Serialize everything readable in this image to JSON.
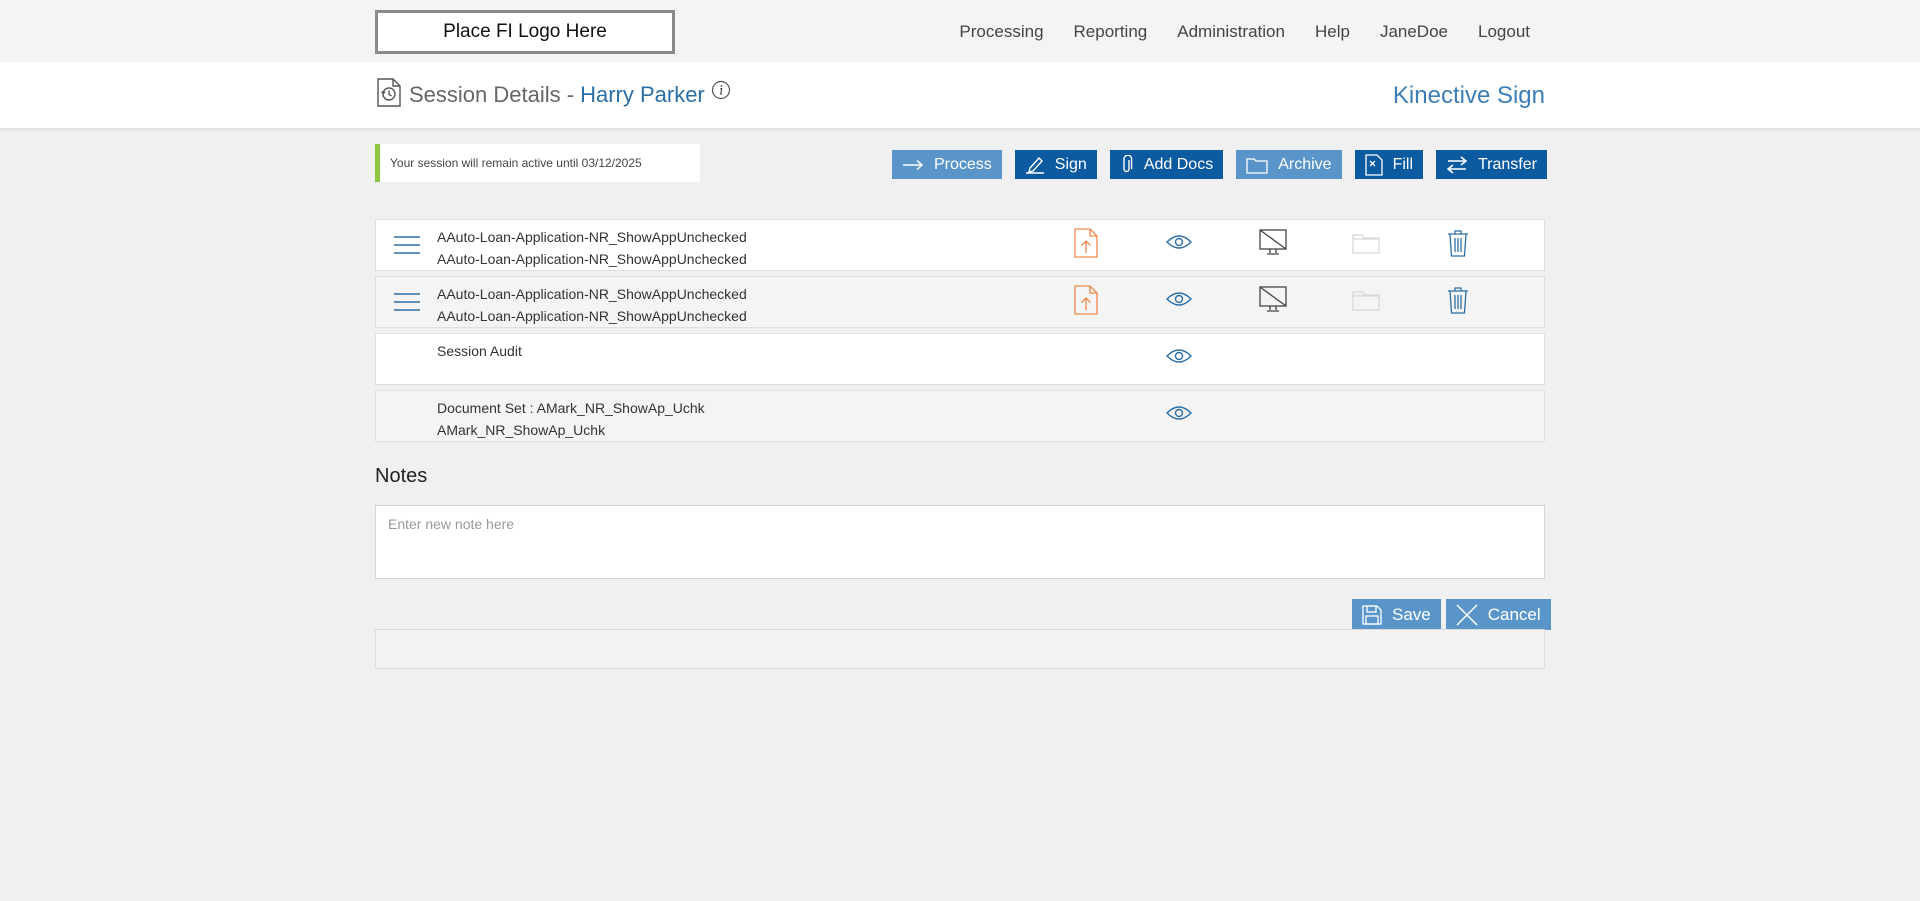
{
  "header": {
    "logo_text": "Place FI Logo Here",
    "nav": [
      "Processing",
      "Reporting",
      "Administration",
      "Help",
      "JaneDoe",
      "Logout"
    ]
  },
  "title": {
    "prefix": "Session Details -",
    "name": "Harry Parker",
    "brand": "Kinective Sign"
  },
  "session_notice": "Your session will remain active until 03/12/2025",
  "actions": {
    "process": "Process",
    "sign": "Sign",
    "add_docs": "Add Docs",
    "archive": "Archive",
    "fill": "Fill",
    "transfer": "Transfer"
  },
  "documents": [
    {
      "line1": "AAuto-Loan-Application-NR_ShowAppUnchecked",
      "line2": "AAuto-Loan-Application-NR_ShowAppUnchecked"
    },
    {
      "line1": "AAuto-Loan-Application-NR_ShowAppUnchecked",
      "line2": "AAuto-Loan-Application-NR_ShowAppUnchecked"
    },
    {
      "line1": "Session Audit",
      "line2": ""
    },
    {
      "line1": "Document Set : AMark_NR_ShowAp_Uchk",
      "line2": "AMark_NR_ShowAp_Uchk"
    }
  ],
  "notes": {
    "heading": "Notes",
    "placeholder": "Enter new note here",
    "save": "Save",
    "cancel": "Cancel"
  },
  "colors": {
    "accent": "#2b6fa6",
    "button_light": "#5a95c9",
    "button_dark": "#0c5aa0",
    "upload_orange": "#f08a4b",
    "notice_green": "#8cc63f"
  }
}
